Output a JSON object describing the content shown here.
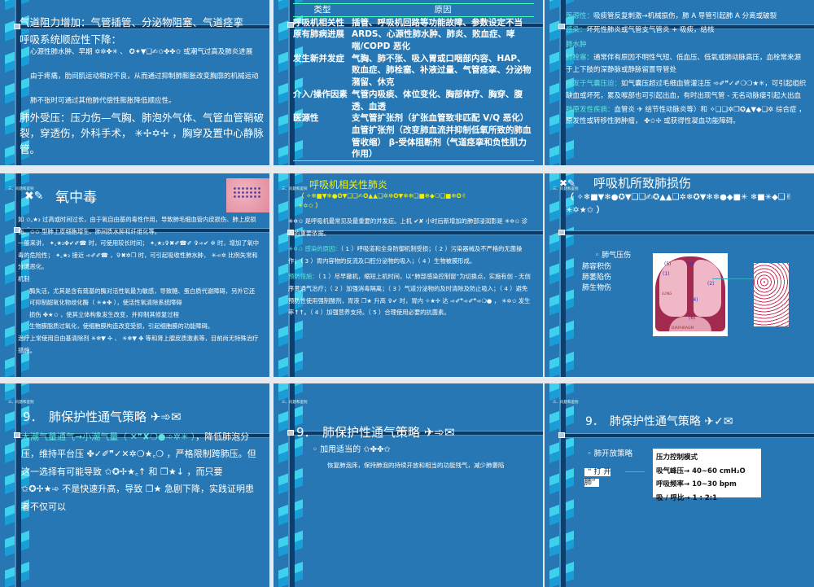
{
  "slides": [
    {
      "lines": [
        "气道阻力增加：气管插管、分泌物阻塞、气道痉挛",
        "呼吸系统顺应性下降：",
        "心源性肺水肿、早期 ✡✲✤✳ 、 ✪✦▼❑✍✩✤✤✩ 或潮气过高及肺炎进展",
        "由于疼痛，肋间肌运动相对不良，从而通过抑制肺膨胀改变胸廓的机械运动",
        "肺不张时可通过其他肺代偿性膨胀降低顺应性。",
        "肺外受压：压力伤—气胸、肺泡外气体、气管血管鞘破裂，穿透伤，外科手术， ✳✢✡✢ ，胸穿及置中心静脉管。"
      ]
    },
    {
      "headers": [
        "类型",
        "原因"
      ],
      "rows": [
        [
          "呼吸机相关性",
          "插管、呼吸机回路等功能故障、参数设定不当"
        ],
        [
          "原有肺病进展",
          "ARDS、心源性肺水肿、肺炎、败血症、哮喘/COPD 恶化"
        ],
        [
          "发生新并发症",
          "气胸、肺不张、吸入胃或口咽部内容、HAP、败血症、肺栓塞、补液过量、气管痉挛、分泌物潴留、休克"
        ],
        [
          "介入/操作因素",
          "气管内吸痰、体位变化、胸部体疗、胸穿、腹透、血透"
        ],
        [
          "医源性",
          "支气管扩张剂（扩张血管致非匹配 V/Q 恶化） 血管扩张剂（改变肺血流并抑制低氧所致的肺血管收缩） β-受体阻断剂（气道痉挛和负性肌力作用）"
        ]
      ]
    },
    {
      "items": [
        {
          "k": "医源性：",
          "v": "吸痰管反复刺激→机械损伤，肺 A 导管引起肺 A 分离或破裂"
        },
        {
          "k": "感染：",
          "v": "坏死性肺炎或气管支气管炎 + 吸痰，结核"
        },
        {
          "k": "肺水肿",
          "v": ""
        },
        {
          "k": "肺栓塞：",
          "v": "通常伴有原因不明性气短、低血压、低氧或肺动脉高压，血栓常来源于上下肢的深静脉或静脉留置导管处"
        },
        {
          "k": "继发于气囊压迫：",
          "v": "如气囊压超过毛细血管灌注压 ➾✐❞✓✐❍❍★✳，可引起组织缺血或坏死，累及喉部也可引起出血，有时出现气管 - 无名动脉瘘引起大出血"
        },
        {
          "k": "肺原发性疾病：",
          "v": "血管炎 ✈ 结节性动脉炎等）和 ✧❑❑✲❒✪▲▼◆❑✲ 综合症 ，原发性或转移性肺肿瘤， ✤✩✢ 或获得性凝血功能障碍。"
        }
      ]
    },
    {
      "header": "三、问题和鉴别",
      "title": "氧中毒",
      "lines": [
        "如 ✩꜀★₂ 过高或时间过长，由于氧自由基的毒性作用，导致肺毛细血管内皮损伤、肺上皮损伤、✩✩ 型肺上皮细胞增生、肺间质水肿和纤维化等。",
        "一般来讲， ✦꜀★₂✤✔✐☎ 时，可使用较长时间； ✦꜀★₂✞✖✐☎✐ ✞➾✔ ✲ 时，增加了氧中毒的危险性； ✦꜀★₂ 接近 ➾✐✐☎ ，✞✖✲❒ 时，可引起吸收性肺水肿， ✳➾✲ 比例失常和分流恶化。",
        "机制",
        "酶失活，尤其是含有巯基的酶对活性氧最为敏感，导致糖、蛋白质代谢障碍，另外它还可抑制超氧化物歧化酶（ ✳★✤ ），使活性氧清除系统障碍",
        "损伤 ✤★✩ ，使其立体构象发生改变，并抑制其修复过程",
        "生物膜脂质过氧化，使细胞膜构造改变受损，引起细胞膜的功能障碍。",
        "治疗上常使用自由基清除剂 ✳❄▼ ✢ 、 ✳❄▼ ✤ 等和肾上腺皮质激素等，目前尚无特殊治疗措施。"
      ]
    },
    {
      "header": "三、问题和鉴别",
      "title": "呼吸机相关性肺炎",
      "subtitle": "（ ✧❄■▼❄●✪▼❑❑✍✪▲▲❑✲❄✪▼❄❄❑■❄◆❍❑■❄✪✌ ✳✡✩ ）",
      "items": [
        {
          "k": "",
          "v": "✳✡✩ 是呼吸机最常见及最重要的并发症。上机 ✔✘ 小时后新增加的肺部浸润影是 ✳✡✩ 诊断的重要依据。"
        },
        {
          "k": "✳✡✩ 感染的原因：",
          "v": "（ 1 ）呼吸道和全身防御机制受损；（ 2 ）污染器械及不严格的无菌操作；（ 3 ）胃内容物的反流及口腔分泌物的吸入；（ 4 ）生物被膜形成。"
        },
        {
          "k": "预防措施：",
          "v": "（ 1 ）尽早撤机，缩短上机时间，以“肺部感染控制窗”为切换点，实施有创 - 无创序贯通气治疗；（ 2 ）加强消毒隔离；（ 3 ）气道分泌物的及时清除及防止吸入；（ 4 ）避免预防性使用强制酸剂，胃液 ❒★ 升高 ✞✔ 时，胃内 ✧★✢ 达 ➾✐❞➾✐❞➾❍● ， ✳✡✩ 发生率↑↑。（ 4 ）加强营养支持。（ 5 ）合理使用必要的抗菌素。"
        }
      ]
    },
    {
      "header": "三、问题和鉴别",
      "title": "呼吸机所致肺损伤",
      "subtitle": "（ ✧❄■▼❄●✪▼❑❑✍✪▲▲❑✲❄✪▼❄❄●◆■✳ ❄■✳◆❑✌ ✳✡★✩ ）",
      "bullet": "肺气压伤",
      "lines": [
        "肺容积伤",
        "肺萎陷伤",
        "肺生物伤"
      ],
      "diagram_labels": [
        "(5)",
        "(3)",
        "(1)",
        "(2)",
        "Lung",
        "(4)",
        "(6)",
        "Diaphragm"
      ]
    },
    {
      "header": "三、问题和鉴别",
      "title": "9．　肺保护性通气策略 ✈➾✉",
      "lead": "大潮气量通气→小潮气量（ ✕❞✘❍●➾✲✳ ）",
      "text": "，降低肺泡分压，维持平台压 ✤✓✐❞✓✕✲❍★꜀❍ ，严格限制跨肺压。但这一选择有可能导致 ✩✪✢★꜀↑ 和 ❒★↓ ，而只要 ✩✪✢★➾ 不是快速升高，导致 ❒★ 急剧下降，实践证明患者不仅可以"
    },
    {
      "header": "三、问题和鉴别",
      "title": "9．　肺保护性通气策略 ✈➾✉",
      "bullet": "加用适当的 ✩✤✤✩",
      "sub": "恢复肺泡床，保持肺泡的持续开放和相当的功能残气，减少肺萎陷"
    },
    {
      "header": "三、问题和鉴别",
      "title": "9．　肺保护性通气策略 ✈✓✉",
      "bullet": "肺开放策略",
      "label": "“ 打 开 肺”",
      "box": [
        "压力控制模式",
        "吸气峰压→ 40~60 cmH₂O",
        "呼吸频率→ 10~30 bpm",
        "吸 / 呼比→ 1 : 2:1"
      ]
    }
  ]
}
